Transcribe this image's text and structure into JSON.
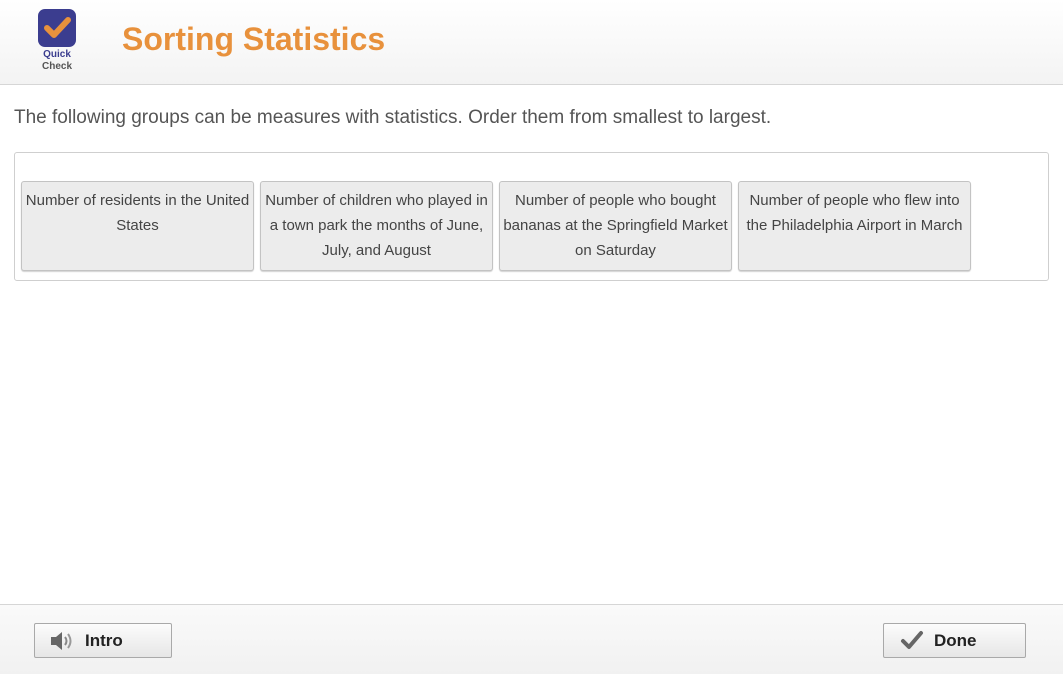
{
  "header": {
    "logo_line1": "Quick",
    "logo_line2": "Check",
    "title": "Sorting Statistics"
  },
  "instructions": "The following groups can be measures with statistics. Order them from smallest to largest.",
  "cards": [
    "Number of residents in the United States",
    "Number of children who played in a town park the months of June, July, and August",
    "Number of people who bought bananas at the Springfield Market on Saturday",
    "Number of people who flew into the Philadelphia Airport in March"
  ],
  "footer": {
    "intro_label": "Intro",
    "done_label": "Done"
  },
  "colors": {
    "title": "#e8913c",
    "logo_badge": "#3b3d8f",
    "logo_check": "#e8913c"
  },
  "icons": {
    "logo": "quick-check-logo-icon",
    "intro": "speaker-icon",
    "done": "checkmark-icon"
  }
}
